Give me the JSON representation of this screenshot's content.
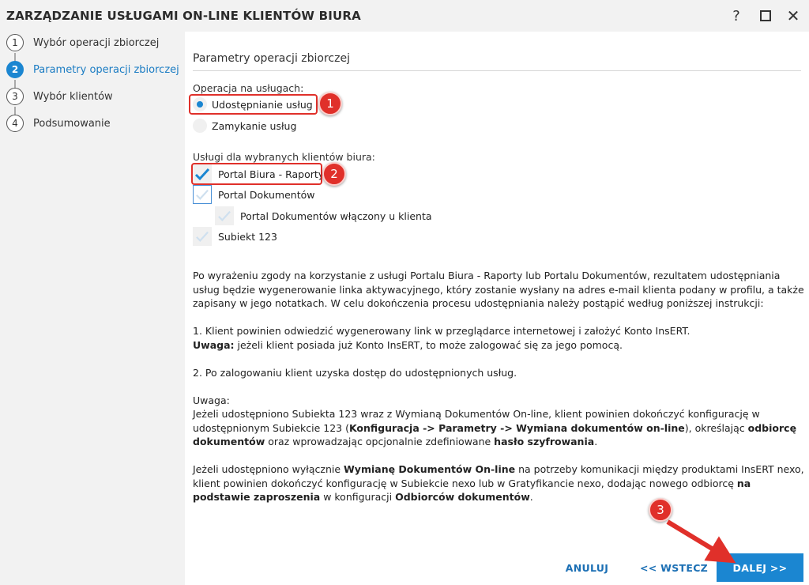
{
  "window": {
    "title": "ZARZĄDZANIE USŁUGAMI ON-LINE KLIENTÓW BIURA",
    "help_label": "?",
    "close_label": "✕"
  },
  "steps": [
    {
      "num": "1",
      "label": "Wybór operacji zbiorczej",
      "active": false
    },
    {
      "num": "2",
      "label": "Parametry operacji zbiorczej",
      "active": true
    },
    {
      "num": "3",
      "label": "Wybór klientów",
      "active": false
    },
    {
      "num": "4",
      "label": "Podsumowanie",
      "active": false
    }
  ],
  "main": {
    "section_title": "Parametry operacji zbiorczej",
    "operation_group_label": "Operacja na usługach:",
    "radios": [
      {
        "label": "Udostępnianie usług",
        "selected": true
      },
      {
        "label": "Zamykanie usług",
        "selected": false
      }
    ],
    "services_group_label": "Usługi dla wybranych klientów biura:",
    "checkboxes": [
      {
        "label": "Portal Biura - Raporty",
        "checked": true
      },
      {
        "label": "Portal Dokumentów",
        "checked": false
      },
      {
        "label": "Portal Dokumentów włączony u klienta",
        "checked": false
      },
      {
        "label": "Subiekt 123",
        "checked": false
      }
    ],
    "info": {
      "p1": "Po wyrażeniu zgody na korzystanie z usługi Portalu Biura - Raporty lub Portalu Dokumentów, rezultatem udostępniania usług będzie wygenerowanie linka aktywacyjnego, który zostanie wysłany na adres e-mail klienta podany w profilu, a także zapisany w jego notatkach. W celu dokończenia procesu udostępniania należy postąpić według poniższej instrukcji:",
      "p2": "1. Klient powinien odwiedzić wygenerowany link w przeglądarce internetowej i założyć Konto InsERT.",
      "p3_bold": "Uwaga:",
      "p3_rest": " jeżeli klient posiada już Konto InsERT, to może zalogować się za jego pomocą.",
      "p4": "2. Po zalogowaniu klient uzyska dostęp do udostępnionych usług.",
      "p5": "Uwaga:",
      "p6_a": "Jeżeli udostępniono Subiekta 123 wraz z Wymianą Dokumentów On-line, klient powinien dokończyć konfigurację w udostępnionym Subiekcie 123 (",
      "p6_b": "Konfiguracja -> Parametry -> Wymiana dokumentów on-line",
      "p6_c": "), określając ",
      "p6_d": "odbiorcę dokumentów",
      "p6_e": " oraz wprowadzając opcjonalnie zdefiniowane ",
      "p6_f": "hasło szyfrowania",
      "p6_g": ".",
      "p7_a": "Jeżeli udostępniono wyłącznie ",
      "p7_b": "Wymianę Dokumentów On-line",
      "p7_c": " na potrzeby komunikacji między produktami InsERT nexo, klient powinien dokończyć konfigurację w Subiekcie nexo lub w Gratyfikancie nexo, dodając nowego odbiorcę ",
      "p7_d": "na podstawie zaproszenia",
      "p7_e": " w konfiguracji ",
      "p7_f": "Odbiorców dokumentów",
      "p7_g": "."
    }
  },
  "footer": {
    "cancel_label": "ANULUJ",
    "back_label": "<< WSTECZ",
    "next_label": "DALEJ >>"
  },
  "annotations": {
    "marker1": "1",
    "marker2": "2",
    "marker3": "3"
  },
  "colors": {
    "accent": "#1b86d1",
    "annotation_red": "#e0302a"
  }
}
